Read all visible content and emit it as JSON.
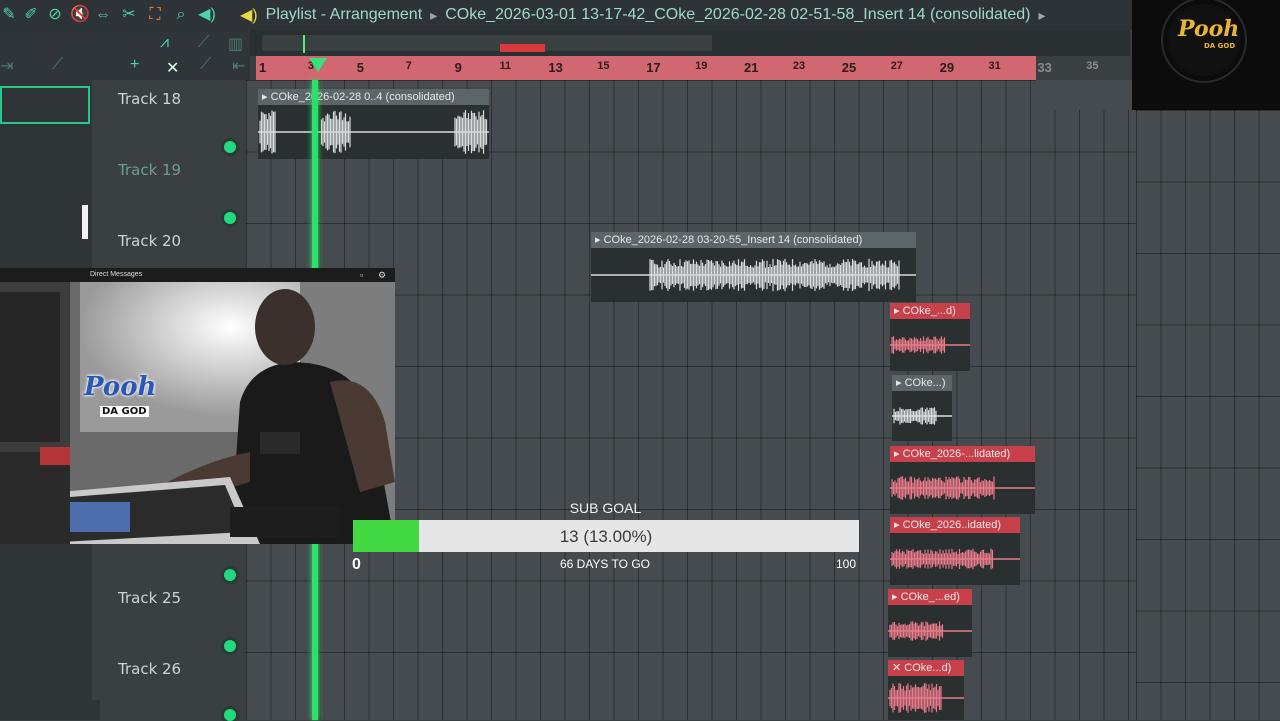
{
  "playlist": {
    "title": "Playlist - Arrangement",
    "breadcrumb": "COke_2026-03-01 13-17-42_COke_2026-02-28 02-51-58_Insert 14 (consolidated)",
    "arrow": "▸"
  },
  "ruler": {
    "ticks": [
      "1",
      "3",
      "5",
      "7",
      "9",
      "11",
      "13",
      "15",
      "17",
      "19",
      "21",
      "23",
      "25",
      "27",
      "29",
      "31",
      "33",
      "35"
    ]
  },
  "tracks": [
    {
      "label": "Track 18"
    },
    {
      "label": "Track 19"
    },
    {
      "label": "Track 20"
    },
    {
      "label": "Track 25"
    },
    {
      "label": "Track 26"
    }
  ],
  "clips": [
    {
      "name": "COke_2026-02-28 0..4 (consolidated)",
      "color": "grey"
    },
    {
      "name": "COke_2026-02-28 03-20-55_Insert 14 (consolidated)",
      "color": "grey"
    },
    {
      "name": "COke_...d)",
      "color": "red"
    },
    {
      "name": "COke...)",
      "color": "grey"
    },
    {
      "name": "COke_2026-...lidated)",
      "color": "red"
    },
    {
      "name": "COke_2026..idated)",
      "color": "red"
    },
    {
      "name": "COke_...ed)",
      "color": "red"
    },
    {
      "name": "COke...d)",
      "color": "red"
    }
  ],
  "webcam": {
    "window_title": "Direct Messages",
    "overlay_logo_line1": "Pooh",
    "overlay_logo_line2": "DA GOD"
  },
  "sub_goal": {
    "title": "SUB GOAL",
    "current_text": "13 (13.00%)",
    "current": 13,
    "min_label": "0",
    "max_label": "100",
    "progress_fraction": 0.13,
    "days_text": "66 DAYS TO GO"
  },
  "brand_logo": {
    "line1": "Pooh",
    "line2": "DA GOD"
  },
  "colors": {
    "accent": "#4cd3b0",
    "playhead": "#2ee06a",
    "ruler": "#d16871",
    "clip_red": "#c8414a",
    "goal_fill": "#43d943"
  }
}
